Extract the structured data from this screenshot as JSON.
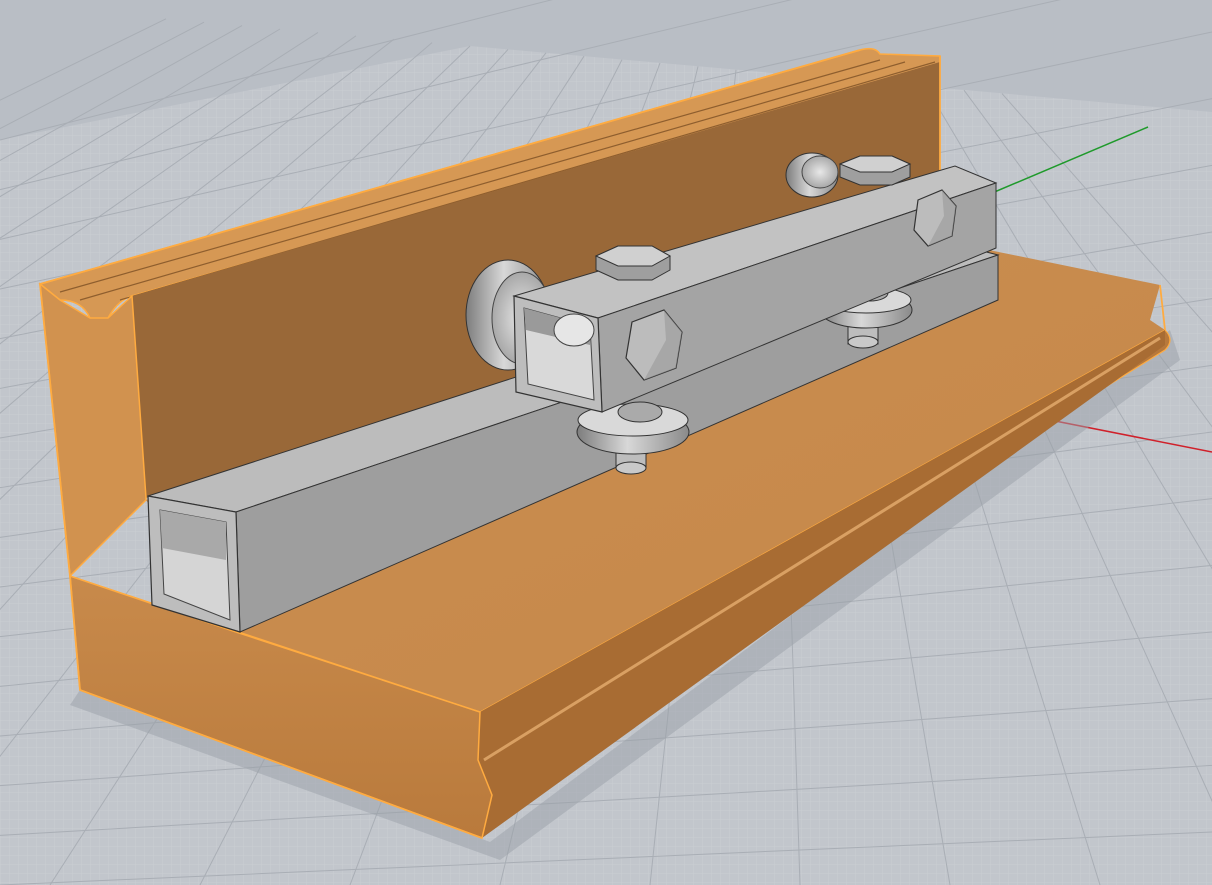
{
  "viewport": {
    "kind": "3d-perspective-viewport",
    "background_color": "#bfc3c9",
    "grid": {
      "visible": true,
      "minor_color": "#cdd1d6",
      "major_color": "#a9aeb5"
    },
    "axes": {
      "x_color": "#d0202a",
      "y_color": "#1f9a2b"
    }
  },
  "model": {
    "objects": [
      {
        "name": "l-shaped-wooden-base",
        "material_color": "#c98b4b",
        "selection_highlight": "#ffab40",
        "selected": true
      },
      {
        "name": "square-tube-rail",
        "material_color": "#a6a6a6"
      },
      {
        "name": "trolley-square-tube",
        "material_color": "#b2b2b2"
      },
      {
        "name": "hex-bolt",
        "material_color": "#b7b7b7",
        "count": 4
      },
      {
        "name": "guide-wheel",
        "material_color": "#c2c2c2",
        "count": 4
      }
    ]
  }
}
